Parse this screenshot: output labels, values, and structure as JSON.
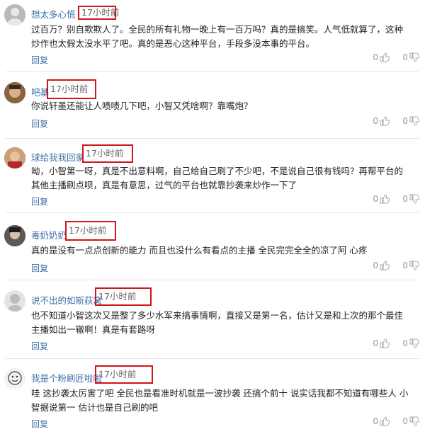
{
  "comments": [
    {
      "username": "想太多心慌",
      "time": "17小时前",
      "content": "过百万？别自欺欺人了。全民的所有礼物一晚上有一百万吗？真的是搞笑。人气低就算了，这种炒作也太假太没水平了吧。真的是恶心这种平台，手段多没本事的平台。",
      "reply": "回复",
      "likes": "0",
      "dislikes": "0"
    },
    {
      "username": "吧基",
      "time": "17小时前",
      "content": "你说轩墨还能让人啧啧几下吧，小智又凭啥啊？靠嘴炮？",
      "reply": "回复",
      "likes": "0",
      "dislikes": "0"
    },
    {
      "username": "球给我我回家",
      "time": "17小时前",
      "content": "呦，小智第一呀，真是不出意料啊，自己给自己刷了不少吧，不是说自己很有钱吗？再帮平台的其他主播刷点呗，真是有意思，过气的平台也就靠抄袭来炒作一下了",
      "reply": "回复",
      "likes": "0",
      "dislikes": "0"
    },
    {
      "username": "毒奶奶奶",
      "time": "17小时前",
      "content": "真的是没有一点点创新的能力 而且也没什么有看点的主播 全民完完全全的凉了阿 心疼",
      "reply": "回复",
      "likes": "0",
      "dislikes": "0"
    },
    {
      "username": "说不出的如斯荻窝",
      "time": "17小时前",
      "content": "也不知道小智这次又是整了多少水军来搞事情啊，直接又是第一名，估计又是和上次的那个最佳主播如出一辙啊！真是有套路呀",
      "reply": "回复",
      "likes": "0",
      "dislikes": "0"
    },
    {
      "username": "我是个粉刷匠啦啦",
      "time": "17小时前",
      "content": "哇 这抄袭太厉害了吧 全民也是看准时机就是一波抄袭 还搞个前十 说实话我都不知道有哪些人 小智据说第一 估计也是自己刷的吧",
      "reply": "回复",
      "likes": "0",
      "dislikes": "0"
    }
  ]
}
